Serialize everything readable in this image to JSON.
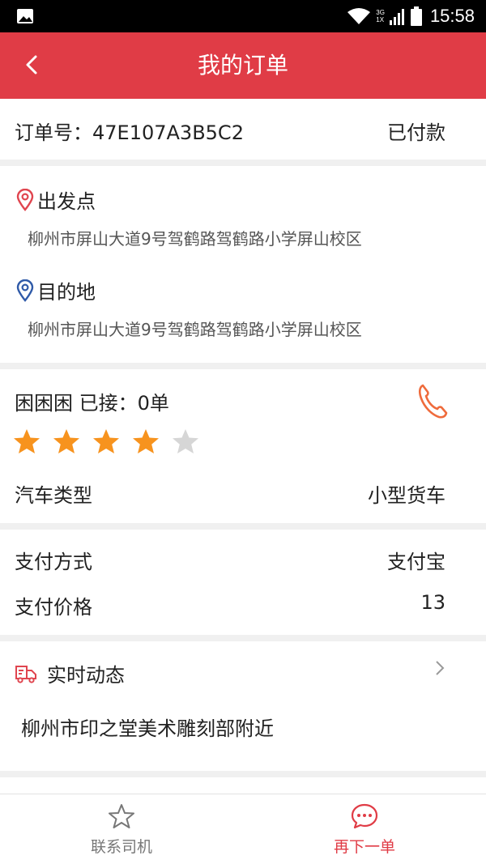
{
  "status_bar": {
    "time": "15:58",
    "network_top": "3G",
    "network_bottom": "1X"
  },
  "app_bar": {
    "title": "我的订单"
  },
  "order": {
    "number_label": "订单号：47E107A3B5C2",
    "status": "已付款"
  },
  "route": {
    "origin_label": "出发点",
    "origin_address": "柳州市屏山大道9号驾鹤路驾鹤路小学屏山校区",
    "destination_label": "目的地",
    "destination_address": "柳州市屏山大道9号驾鹤路驾鹤路小学屏山校区"
  },
  "driver": {
    "name_and_orders": "困困困  已接：0单",
    "rating": 4,
    "rating_max": 5,
    "vehicle_type_label": "汽车类型",
    "vehicle_type_value": "小型货车"
  },
  "payment": {
    "method_label": "支付方式",
    "method_value": "支付宝",
    "price_label": "支付价格",
    "price_value": "13"
  },
  "realtime": {
    "title": "实时动态",
    "location": "柳州市印之堂美术雕刻部附近"
  },
  "tab_bar": {
    "contact_driver": "联系司机",
    "reorder": "再下一单"
  },
  "colors": {
    "brand_red": "#e03c46",
    "star_filled": "#f7931e",
    "star_empty": "#d6d6d6",
    "origin_icon": "#e0454f",
    "destination_icon": "#2f5aa8",
    "phone_icon": "#ef6b3c"
  },
  "icons": {
    "back": "chevron-left-icon",
    "origin": "location-pin-icon",
    "destination": "location-pin-icon",
    "phone": "phone-icon",
    "realtime": "truck-icon",
    "more": "chevron-right-icon",
    "contact": "star-outline-icon",
    "reorder": "chat-bubble-icon"
  }
}
